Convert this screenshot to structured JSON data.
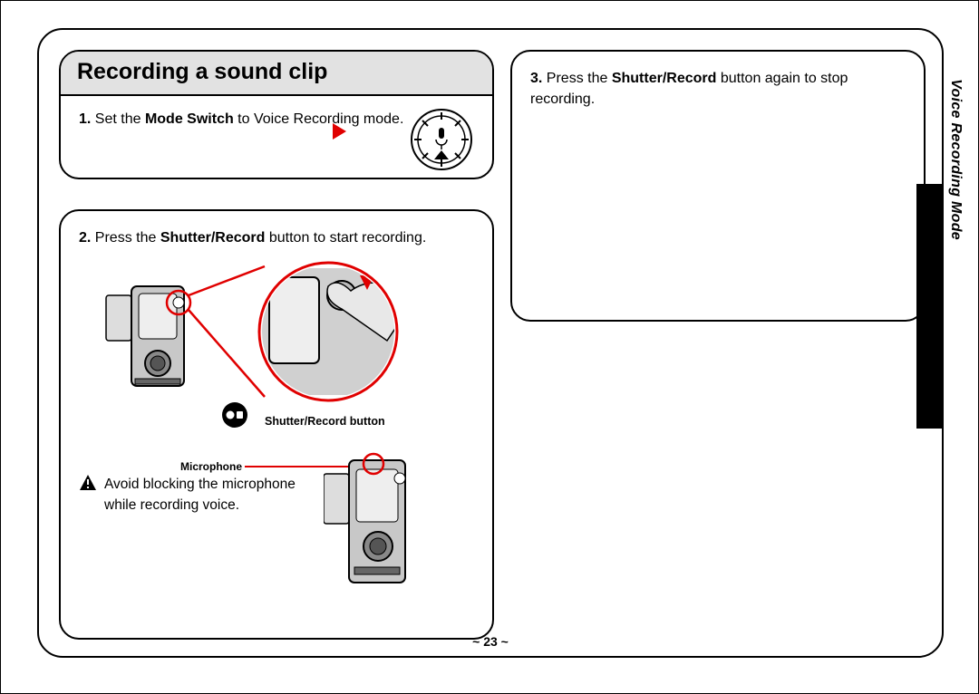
{
  "title": "Recording a sound clip",
  "side_tab": "Voice Recording Mode",
  "page_number": "~ 23 ~",
  "step1": {
    "num": "1.",
    "pre": "Set the ",
    "bold": "Mode Switch",
    "post": " to Voice Recording mode."
  },
  "step2": {
    "num": "2.",
    "pre": "Press the ",
    "bold": "Shutter/Record",
    "post": " button to start recording."
  },
  "step3": {
    "num": "3.",
    "pre": "Press the ",
    "bold": "Shutter/Record",
    "post": " button again to stop recording."
  },
  "labels": {
    "shutter_button": "Shutter/Record button",
    "microphone": "Microphone"
  },
  "warning": "Avoid blocking the microphone while recording voice."
}
